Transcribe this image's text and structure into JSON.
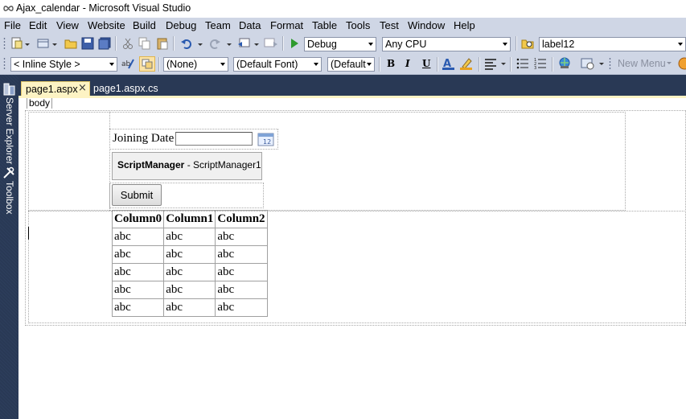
{
  "window": {
    "title": "Ajax_calendar - Microsoft Visual Studio"
  },
  "menu": {
    "items": [
      "File",
      "Edit",
      "View",
      "Website",
      "Build",
      "Debug",
      "Team",
      "Data",
      "Format",
      "Table",
      "Tools",
      "Test",
      "Window",
      "Help"
    ]
  },
  "toolbar1": {
    "solution_config": "Debug",
    "platform": "Any CPU",
    "find_box": "label12"
  },
  "toolbar2": {
    "style_mode": "< Inline Style >",
    "block_format": "(None)",
    "font_name": "(Default Font)",
    "font_size": "(Default",
    "bold": "B",
    "italic": "I",
    "underline": "U",
    "new_menu": "New Menu"
  },
  "siderail": {
    "server_explorer": "Server Explorer",
    "toolbox": "Toolbox"
  },
  "tabs": {
    "active": "page1.aspx",
    "inactive": "page1.aspx.cs",
    "close": "×"
  },
  "designer": {
    "tag_selector": "body",
    "joining_label": "Joining Date",
    "calendar_icon_text": "12",
    "script_manager_type": "ScriptManager",
    "script_manager_id": " - ScriptManager1",
    "submit_label": "Submit",
    "grid": {
      "columns": [
        "Column0",
        "Column1",
        "Column2"
      ],
      "rows": [
        [
          "abc",
          "abc",
          "abc"
        ],
        [
          "abc",
          "abc",
          "abc"
        ],
        [
          "abc",
          "abc",
          "abc"
        ],
        [
          "abc",
          "abc",
          "abc"
        ],
        [
          "abc",
          "abc",
          "abc"
        ]
      ]
    }
  },
  "colors": {
    "chrome": "#cfd6e5",
    "rail": "#293955",
    "active_tab": "#fdf3c4"
  }
}
